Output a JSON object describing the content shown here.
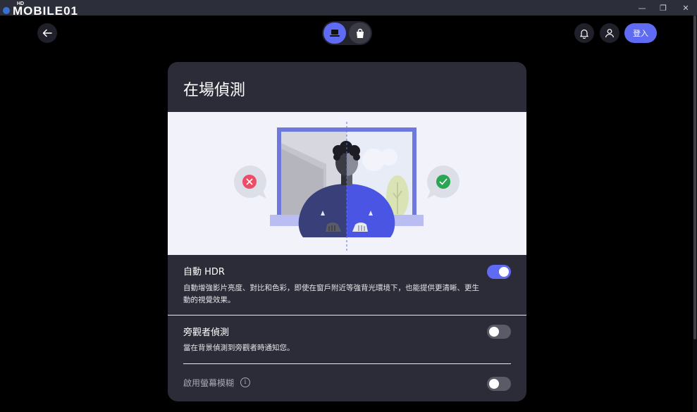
{
  "logo": {
    "brand": "MOBILE01",
    "hd": "HD"
  },
  "window": {
    "minimize": "—",
    "restore": "❐",
    "close": "✕"
  },
  "appbar": {
    "login_label": "登入"
  },
  "card": {
    "title": "在場偵測",
    "settings": [
      {
        "title": "自動 HDR",
        "description": "自動增強影片亮度、對比和色彩，即使在窗戶附近等強背光環境下，也能提供更清晰、更生動的視覺效果。",
        "enabled": true
      },
      {
        "title": "旁觀者偵測",
        "description": "當在背景偵測到旁觀者時通知您。",
        "enabled": false
      },
      {
        "title": "啟用螢幕模糊",
        "info": "i",
        "enabled": false
      }
    ]
  },
  "colors": {
    "accent": "#5f6bf2",
    "card": "#2b2c37",
    "background": "#000000"
  }
}
